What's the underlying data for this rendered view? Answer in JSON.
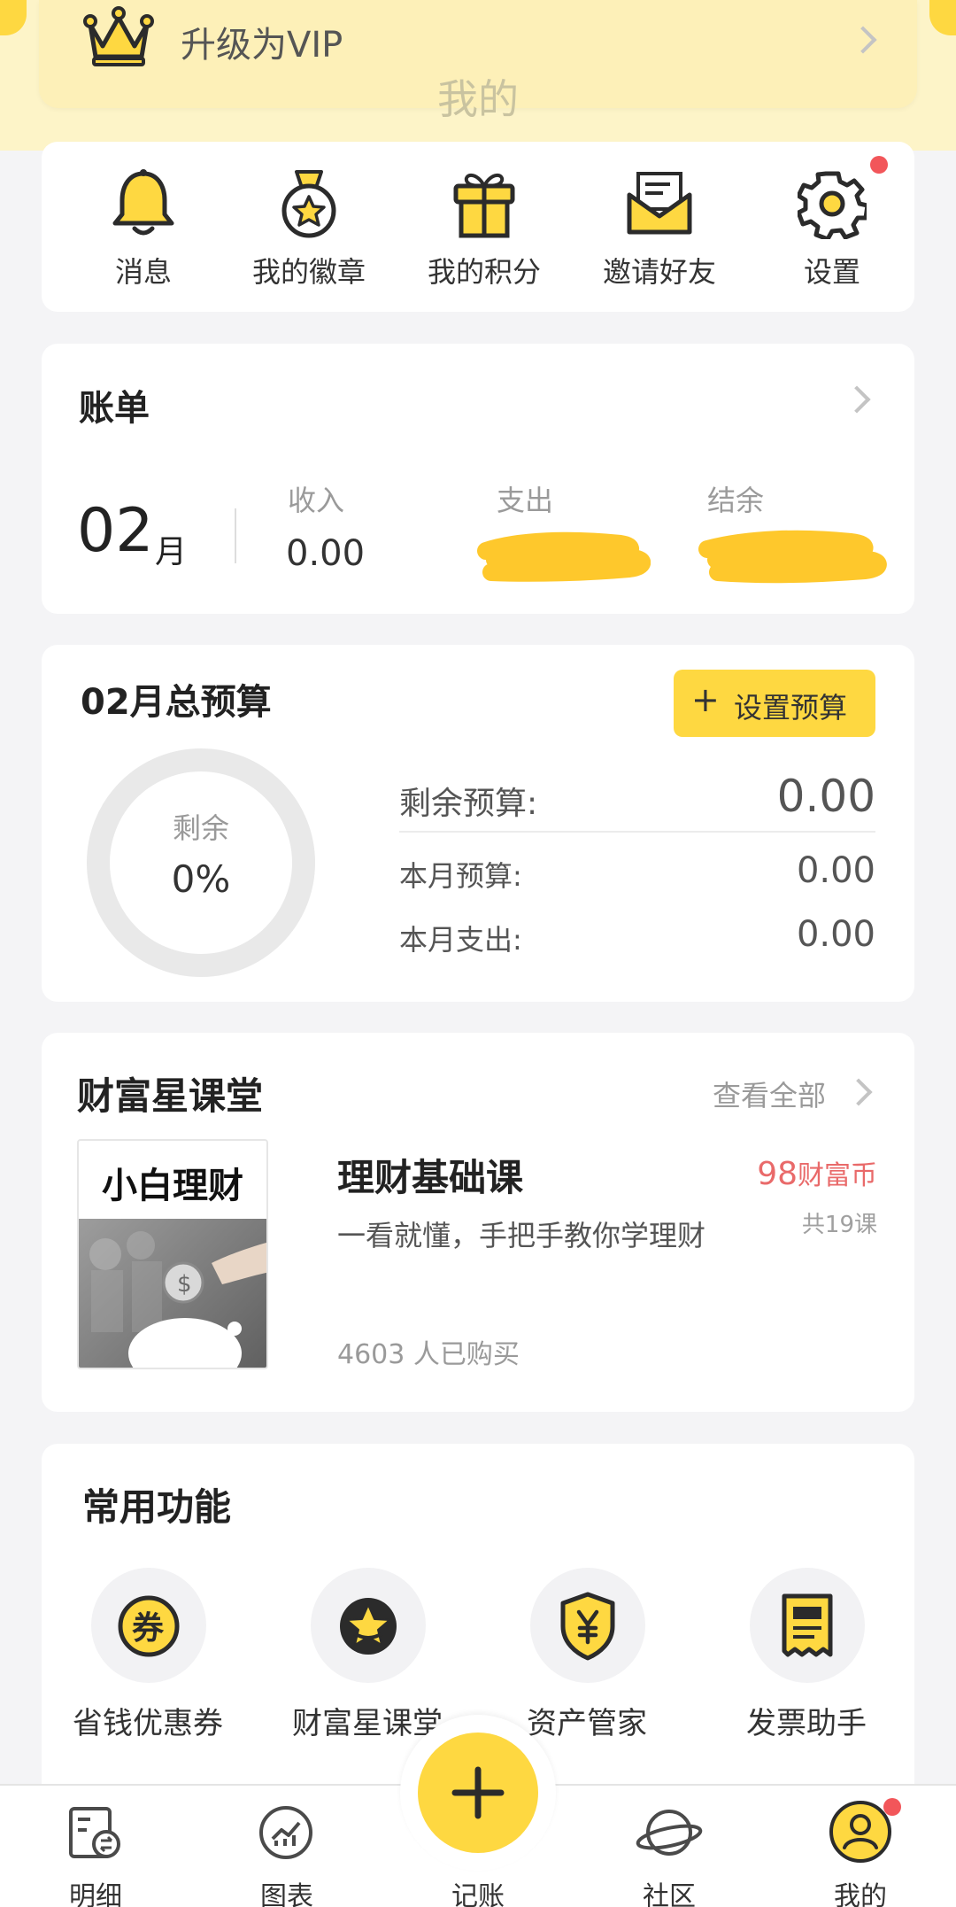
{
  "header": {
    "vip_label": "升级为VIP",
    "page_title": "我的"
  },
  "quick_menu": {
    "items": [
      {
        "label": "消息",
        "icon": "bell-icon"
      },
      {
        "label": "我的徽章",
        "icon": "medal-icon"
      },
      {
        "label": "我的积分",
        "icon": "gift-icon"
      },
      {
        "label": "邀请好友",
        "icon": "envelope-icon"
      },
      {
        "label": "设置",
        "icon": "gear-icon"
      }
    ]
  },
  "bill": {
    "title": "账单",
    "month_number": "02",
    "month_unit": "月",
    "income_label": "收入",
    "income_value": "0.00",
    "expense_label": "支出",
    "balance_label": "结余"
  },
  "budget": {
    "title": "02月总预算",
    "set_button_label": "设置预算",
    "ring_label": "剩余",
    "ring_percent": "0%",
    "remaining_label": "剩余预算:",
    "remaining_value": "0.00",
    "monthly_label": "本月预算:",
    "monthly_value": "0.00",
    "spent_label": "本月支出:",
    "spent_value": "0.00"
  },
  "classroom": {
    "title": "财富星课堂",
    "view_all_label": "查看全部",
    "course": {
      "thumb_title": "小白理财",
      "name": "理财基础课",
      "description": "一看就懂，手把手教你学理财",
      "buyers": "4603 人已购买",
      "price_number": "98",
      "price_unit": "财富币",
      "lessons": "共19课"
    }
  },
  "common_functions": {
    "title": "常用功能",
    "items": [
      {
        "label": "省钱优惠券",
        "icon": "coupon-icon"
      },
      {
        "label": "财富星课堂",
        "icon": "star-badge-icon"
      },
      {
        "label": "资产管家",
        "icon": "yen-shield-icon"
      },
      {
        "label": "发票助手",
        "icon": "receipt-icon"
      }
    ]
  },
  "tab_bar": {
    "items": [
      {
        "label": "明细",
        "icon": "ledger-icon"
      },
      {
        "label": "图表",
        "icon": "chart-icon"
      },
      {
        "label": "记账",
        "icon": "plus-icon"
      },
      {
        "label": "社区",
        "icon": "planet-icon"
      },
      {
        "label": "我的",
        "icon": "user-icon"
      }
    ]
  },
  "colors": {
    "accent_yellow": "#fed841",
    "price_red": "#e96a6a",
    "badge_red": "#f2565a",
    "background": "#f4f4f6"
  }
}
